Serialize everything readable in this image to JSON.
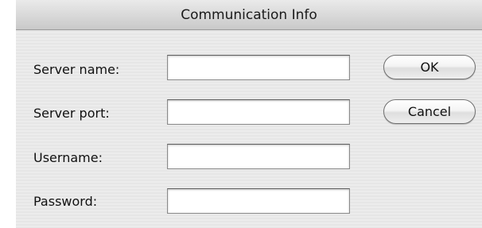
{
  "window": {
    "title": "Communication Info"
  },
  "form": {
    "server_name": {
      "label": "Server name:",
      "value": ""
    },
    "server_port": {
      "label": "Server port:",
      "value": ""
    },
    "username": {
      "label": "Username:",
      "value": ""
    },
    "password": {
      "label": "Password:",
      "value": ""
    }
  },
  "buttons": {
    "ok_label": "OK",
    "cancel_label": "Cancel"
  }
}
